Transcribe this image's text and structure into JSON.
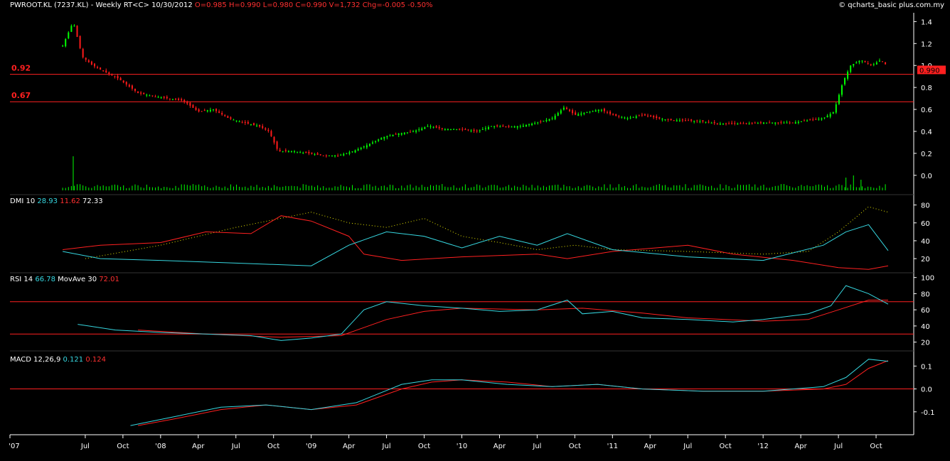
{
  "header": {
    "symbol": "PWROOT.KL (7237.KL) - Weekly RT<C>  10/30/2012",
    "o": "O=0.985",
    "h": "H=0.990",
    "l": "L=0.980",
    "c": "C=0.990",
    "v": "V=1,732",
    "chg": "Chg=-0.005",
    "pct": "-0.50%",
    "credit": "© qcharts_basic plus.com.my"
  },
  "colors": {
    "up": "#00ff00",
    "down": "#ff1a1a",
    "cyan": "#36d7e0",
    "red": "#ff2020",
    "dotted": "#e6e600",
    "axis": "#ffffff",
    "bg": "#000000",
    "volume": "#00ff00"
  },
  "price_panel": {
    "label_high": "0.92",
    "label_low": "0.67",
    "hline_high": 0.92,
    "hline_low": 0.67,
    "last_price_tag": "0.990",
    "y_ticks": [
      "1.4",
      "1.2",
      "1.0",
      "0.8",
      "0.6",
      "0.4",
      "0.2",
      "0.0"
    ]
  },
  "dmi_panel": {
    "label": "DMI 10",
    "v1": "28.93",
    "v2": "11.62",
    "v3": "72.33",
    "y_ticks": [
      "80",
      "60",
      "40",
      "20"
    ]
  },
  "rsi_panel": {
    "label": "RSI 14",
    "v1": "66.78",
    "ma_label": "MovAve 30",
    "v2": "72.01",
    "hline_high": 70,
    "hline_low": 30,
    "y_ticks": [
      "100",
      "80",
      "60",
      "40",
      "20"
    ]
  },
  "macd_panel": {
    "label": "MACD 12,26,9",
    "v1": "0.121",
    "v2": "0.124",
    "y_ticks": [
      "0.1",
      "0.0",
      "-0.1"
    ]
  },
  "x_axis": {
    "labels": [
      "'07",
      "Jul",
      "Oct",
      "'08",
      "Apr",
      "Jul",
      "Oct",
      "'09",
      "Apr",
      "Jul",
      "Oct",
      "'10",
      "Apr",
      "Jul",
      "Oct",
      "'11",
      "Apr",
      "Jul",
      "Oct",
      "'12",
      "Apr",
      "Jul",
      "Oct"
    ]
  },
  "chart_data": {
    "type": "line",
    "frequency": "weekly",
    "price_close_series": [
      [
        2007.35,
        1.18
      ],
      [
        2007.42,
        1.4
      ],
      [
        2007.48,
        1.08
      ],
      [
        2007.55,
        1.0
      ],
      [
        2007.62,
        0.95
      ],
      [
        2007.72,
        0.88
      ],
      [
        2007.85,
        0.75
      ],
      [
        2007.95,
        0.72
      ],
      [
        2008.05,
        0.7
      ],
      [
        2008.15,
        0.68
      ],
      [
        2008.25,
        0.58
      ],
      [
        2008.35,
        0.6
      ],
      [
        2008.45,
        0.52
      ],
      [
        2008.55,
        0.48
      ],
      [
        2008.65,
        0.45
      ],
      [
        2008.72,
        0.4
      ],
      [
        2008.78,
        0.22
      ],
      [
        2008.88,
        0.22
      ],
      [
        2008.98,
        0.2
      ],
      [
        2009.08,
        0.18
      ],
      [
        2009.18,
        0.18
      ],
      [
        2009.28,
        0.22
      ],
      [
        2009.38,
        0.28
      ],
      [
        2009.48,
        0.35
      ],
      [
        2009.58,
        0.38
      ],
      [
        2009.68,
        0.4
      ],
      [
        2009.78,
        0.45
      ],
      [
        2009.88,
        0.42
      ],
      [
        2010.0,
        0.42
      ],
      [
        2010.1,
        0.4
      ],
      [
        2010.2,
        0.45
      ],
      [
        2010.3,
        0.44
      ],
      [
        2010.4,
        0.45
      ],
      [
        2010.5,
        0.48
      ],
      [
        2010.6,
        0.52
      ],
      [
        2010.68,
        0.62
      ],
      [
        2010.75,
        0.55
      ],
      [
        2010.85,
        0.58
      ],
      [
        2010.92,
        0.6
      ],
      [
        2011.0,
        0.55
      ],
      [
        2011.1,
        0.52
      ],
      [
        2011.2,
        0.55
      ],
      [
        2011.3,
        0.52
      ],
      [
        2011.4,
        0.5
      ],
      [
        2011.5,
        0.5
      ],
      [
        2011.6,
        0.49
      ],
      [
        2011.7,
        0.47
      ],
      [
        2011.8,
        0.47
      ],
      [
        2011.9,
        0.47
      ],
      [
        2012.0,
        0.48
      ],
      [
        2012.1,
        0.48
      ],
      [
        2012.2,
        0.48
      ],
      [
        2012.3,
        0.5
      ],
      [
        2012.4,
        0.52
      ],
      [
        2012.47,
        0.58
      ],
      [
        2012.53,
        0.85
      ],
      [
        2012.58,
        1.0
      ],
      [
        2012.65,
        1.05
      ],
      [
        2012.72,
        1.0
      ],
      [
        2012.78,
        1.05
      ],
      [
        2012.83,
        0.99
      ]
    ],
    "volume_peaks": [
      [
        2007.42,
        0.8
      ],
      [
        2012.55,
        0.3
      ],
      [
        2012.6,
        0.35
      ],
      [
        2012.65,
        0.25
      ]
    ],
    "dmi_plus": [
      [
        2007.35,
        28
      ],
      [
        2007.6,
        20
      ],
      [
        2008.0,
        18
      ],
      [
        2008.5,
        15
      ],
      [
        2009.0,
        12
      ],
      [
        2009.25,
        35
      ],
      [
        2009.5,
        50
      ],
      [
        2009.75,
        45
      ],
      [
        2010.0,
        32
      ],
      [
        2010.25,
        45
      ],
      [
        2010.5,
        35
      ],
      [
        2010.7,
        48
      ],
      [
        2011.0,
        30
      ],
      [
        2011.5,
        22
      ],
      [
        2012.0,
        18
      ],
      [
        2012.4,
        35
      ],
      [
        2012.55,
        50
      ],
      [
        2012.7,
        58
      ],
      [
        2012.83,
        29
      ]
    ],
    "dmi_minus": [
      [
        2007.35,
        30
      ],
      [
        2007.6,
        35
      ],
      [
        2008.0,
        38
      ],
      [
        2008.3,
        50
      ],
      [
        2008.6,
        48
      ],
      [
        2008.8,
        68
      ],
      [
        2009.0,
        62
      ],
      [
        2009.25,
        45
      ],
      [
        2009.35,
        25
      ],
      [
        2009.6,
        18
      ],
      [
        2010.0,
        22
      ],
      [
        2010.5,
        25
      ],
      [
        2010.7,
        20
      ],
      [
        2011.0,
        28
      ],
      [
        2011.5,
        35
      ],
      [
        2011.8,
        25
      ],
      [
        2012.2,
        18
      ],
      [
        2012.5,
        10
      ],
      [
        2012.7,
        8
      ],
      [
        2012.83,
        12
      ]
    ],
    "adx": [
      [
        2007.5,
        20
      ],
      [
        2008.0,
        35
      ],
      [
        2008.5,
        55
      ],
      [
        2009.0,
        72
      ],
      [
        2009.25,
        60
      ],
      [
        2009.5,
        55
      ],
      [
        2009.75,
        65
      ],
      [
        2010.0,
        45
      ],
      [
        2010.25,
        38
      ],
      [
        2010.5,
        30
      ],
      [
        2010.75,
        35
      ],
      [
        2011.0,
        30
      ],
      [
        2011.5,
        28
      ],
      [
        2012.0,
        25
      ],
      [
        2012.3,
        28
      ],
      [
        2012.5,
        50
      ],
      [
        2012.7,
        78
      ],
      [
        2012.83,
        72
      ]
    ],
    "rsi": [
      [
        2007.45,
        42
      ],
      [
        2007.7,
        35
      ],
      [
        2008.0,
        32
      ],
      [
        2008.3,
        30
      ],
      [
        2008.6,
        28
      ],
      [
        2008.8,
        22
      ],
      [
        2009.0,
        25
      ],
      [
        2009.2,
        30
      ],
      [
        2009.35,
        60
      ],
      [
        2009.5,
        70
      ],
      [
        2009.75,
        65
      ],
      [
        2010.0,
        62
      ],
      [
        2010.25,
        58
      ],
      [
        2010.5,
        60
      ],
      [
        2010.7,
        72
      ],
      [
        2010.8,
        55
      ],
      [
        2011.0,
        58
      ],
      [
        2011.2,
        50
      ],
      [
        2011.5,
        48
      ],
      [
        2011.8,
        45
      ],
      [
        2012.0,
        48
      ],
      [
        2012.3,
        55
      ],
      [
        2012.45,
        65
      ],
      [
        2012.55,
        90
      ],
      [
        2012.7,
        80
      ],
      [
        2012.83,
        67
      ]
    ],
    "rsi_ma": [
      [
        2007.85,
        35
      ],
      [
        2008.3,
        30
      ],
      [
        2008.8,
        26
      ],
      [
        2009.2,
        28
      ],
      [
        2009.5,
        48
      ],
      [
        2009.75,
        58
      ],
      [
        2010.0,
        62
      ],
      [
        2010.5,
        60
      ],
      [
        2010.8,
        62
      ],
      [
        2011.2,
        56
      ],
      [
        2011.5,
        50
      ],
      [
        2012.0,
        46
      ],
      [
        2012.3,
        48
      ],
      [
        2012.5,
        60
      ],
      [
        2012.7,
        72
      ],
      [
        2012.83,
        72
      ]
    ],
    "macd": [
      [
        2007.8,
        -0.16
      ],
      [
        2008.1,
        -0.12
      ],
      [
        2008.4,
        -0.08
      ],
      [
        2008.7,
        -0.07
      ],
      [
        2009.0,
        -0.09
      ],
      [
        2009.3,
        -0.06
      ],
      [
        2009.6,
        0.02
      ],
      [
        2009.8,
        0.04
      ],
      [
        2010.0,
        0.04
      ],
      [
        2010.3,
        0.02
      ],
      [
        2010.6,
        0.01
      ],
      [
        2010.9,
        0.02
      ],
      [
        2011.2,
        0.0
      ],
      [
        2011.6,
        -0.01
      ],
      [
        2012.0,
        -0.01
      ],
      [
        2012.4,
        0.01
      ],
      [
        2012.55,
        0.05
      ],
      [
        2012.7,
        0.13
      ],
      [
        2012.83,
        0.121
      ]
    ],
    "macd_signal": [
      [
        2007.85,
        -0.16
      ],
      [
        2008.1,
        -0.13
      ],
      [
        2008.4,
        -0.09
      ],
      [
        2008.7,
        -0.07
      ],
      [
        2009.0,
        -0.09
      ],
      [
        2009.3,
        -0.07
      ],
      [
        2009.6,
        0.0
      ],
      [
        2009.8,
        0.03
      ],
      [
        2010.0,
        0.04
      ],
      [
        2010.3,
        0.03
      ],
      [
        2010.6,
        0.01
      ],
      [
        2010.9,
        0.02
      ],
      [
        2011.2,
        0.0
      ],
      [
        2011.6,
        -0.01
      ],
      [
        2012.0,
        -0.01
      ],
      [
        2012.4,
        0.0
      ],
      [
        2012.55,
        0.02
      ],
      [
        2012.7,
        0.09
      ],
      [
        2012.83,
        0.124
      ]
    ]
  }
}
